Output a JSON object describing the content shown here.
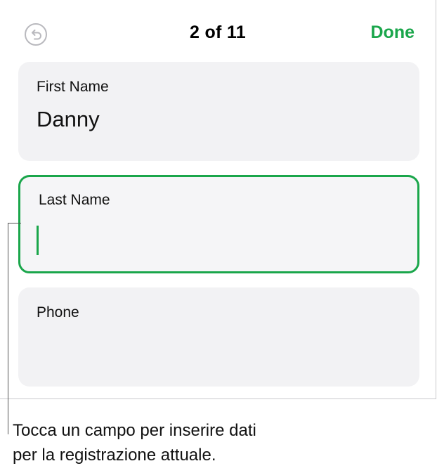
{
  "nav": {
    "undo_icon": "undo-arrow-icon",
    "counter": "2 of 11",
    "done_label": "Done"
  },
  "fields": [
    {
      "label": "First Name",
      "value": "Danny"
    },
    {
      "label": "Last Name",
      "value": ""
    },
    {
      "label": "Phone",
      "value": ""
    }
  ],
  "caption": {
    "line1": "Tocca un campo per inserire dati",
    "line2": "per la registrazione attuale."
  },
  "colors": {
    "accent": "#1aa64b",
    "field_background": "#f2f2f4",
    "divider": "#c9c9cc"
  }
}
